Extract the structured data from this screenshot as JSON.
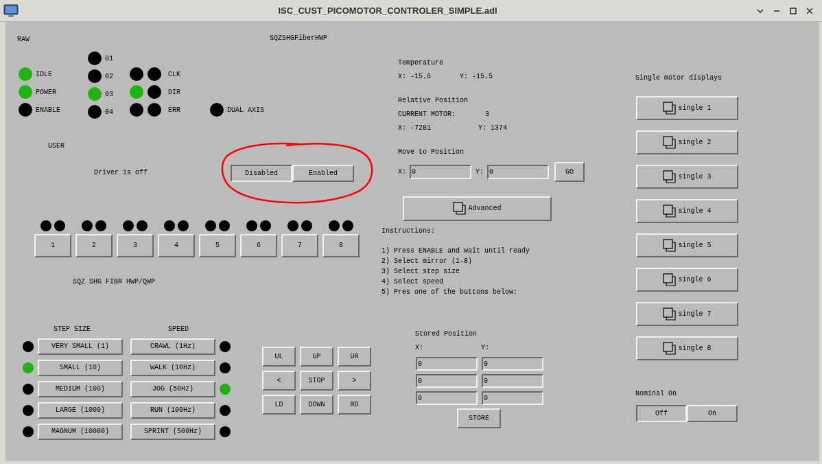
{
  "window": {
    "title": "ISC_CUST_PICOMOTOR_CONTROLER_SIMPLE.adl"
  },
  "raw_label": "RAW",
  "device_label": "SQZSHGFiberHWP",
  "status_leds": [
    {
      "label": "IDLE",
      "on": true
    },
    {
      "label": "POWER",
      "on": true
    },
    {
      "label": "ENABLE",
      "on": false
    }
  ],
  "bit_leds": [
    {
      "label": "01",
      "on": false
    },
    {
      "label": "02",
      "on": false
    },
    {
      "label": "03",
      "on": true
    },
    {
      "label": "04",
      "on": false
    }
  ],
  "signal_leds": [
    {
      "label": "CLK",
      "on": [
        false,
        false
      ]
    },
    {
      "label": "DIR",
      "on": [
        true,
        false
      ]
    },
    {
      "label": "ERR",
      "on": [
        false,
        false
      ]
    }
  ],
  "dual_axis": {
    "label": "DUAL AXIS",
    "on": false
  },
  "user_label": "USER",
  "driver_status": "Driver is off",
  "driver_toggle": [
    {
      "label": "Disabled",
      "selected": true
    },
    {
      "label": "Enabled",
      "selected": false
    }
  ],
  "motors": [
    {
      "label": "1",
      "on": [
        false,
        false
      ]
    },
    {
      "label": "2",
      "on": [
        false,
        false
      ]
    },
    {
      "label": "3",
      "on": [
        false,
        false
      ]
    },
    {
      "label": "4",
      "on": [
        false,
        false
      ]
    },
    {
      "label": "5",
      "on": [
        false,
        false
      ]
    },
    {
      "label": "6",
      "on": [
        false,
        false
      ]
    },
    {
      "label": "7",
      "on": [
        false,
        false
      ]
    },
    {
      "label": "8",
      "on": [
        false,
        false
      ]
    }
  ],
  "group_label": "SQZ SHG FIBR HWP/QWP",
  "step_size": {
    "heading": "STEP SIZE",
    "options": [
      {
        "label": "VERY SMALL (1)",
        "on": false
      },
      {
        "label": "SMALL (10)",
        "on": true
      },
      {
        "label": "MEDIUM (100)",
        "on": false
      },
      {
        "label": "LARGE (1000)",
        "on": false
      },
      {
        "label": "MAGNUM (10000)",
        "on": false
      }
    ]
  },
  "speed": {
    "heading": "SPEED",
    "options": [
      {
        "label": "CRAWL (1Hz)",
        "on": false
      },
      {
        "label": "WALK (10Hz)",
        "on": false
      },
      {
        "label": "JOG (50Hz)",
        "on": true
      },
      {
        "label": "RUN (100Hz)",
        "on": false
      },
      {
        "label": "SPRINT (500Hz)",
        "on": false
      }
    ]
  },
  "jog_buttons": [
    "UL",
    "UP",
    "UR",
    "<",
    "STOP",
    ">",
    "LD",
    "DOWN",
    "RD"
  ],
  "temperature": {
    "heading": "Temperature",
    "x": "X: -15.6",
    "y": "Y: -15.5"
  },
  "relative_position": {
    "heading": "Relative Position",
    "motor_label": "CURRENT MOTOR:",
    "motor_value": "3",
    "x": "X: -7281",
    "y": "Y: 1374"
  },
  "move_to_position": {
    "heading": "Move to Position",
    "fields": [
      {
        "label": "X:",
        "value": "0"
      },
      {
        "label": "Y:",
        "value": "0"
      }
    ],
    "go": "GO"
  },
  "advanced_button": "Advanced",
  "instructions": {
    "heading": "Instructions:",
    "steps": [
      "1) Press ENABLE and wait until ready",
      "2) Select mirror (1-8)",
      "3) Select step size",
      "4) Select speed",
      "5) Pres one of the buttons below:"
    ]
  },
  "stored_position": {
    "heading": "Stored Position",
    "x_label": "X:",
    "y_label": "Y:",
    "rows": [
      [
        "0",
        "0"
      ],
      [
        "0",
        "0"
      ],
      [
        "0",
        "0"
      ]
    ],
    "store": "STORE"
  },
  "single_displays": {
    "heading": "Single motor displays",
    "buttons": [
      "single 1",
      "single 2",
      "single 3",
      "single 4",
      "single 5",
      "single 6",
      "single 7",
      "single 8"
    ]
  },
  "nominal": {
    "heading": "Nominal On",
    "options": [
      {
        "label": "Off",
        "selected": true
      },
      {
        "label": "On",
        "selected": false
      }
    ]
  }
}
